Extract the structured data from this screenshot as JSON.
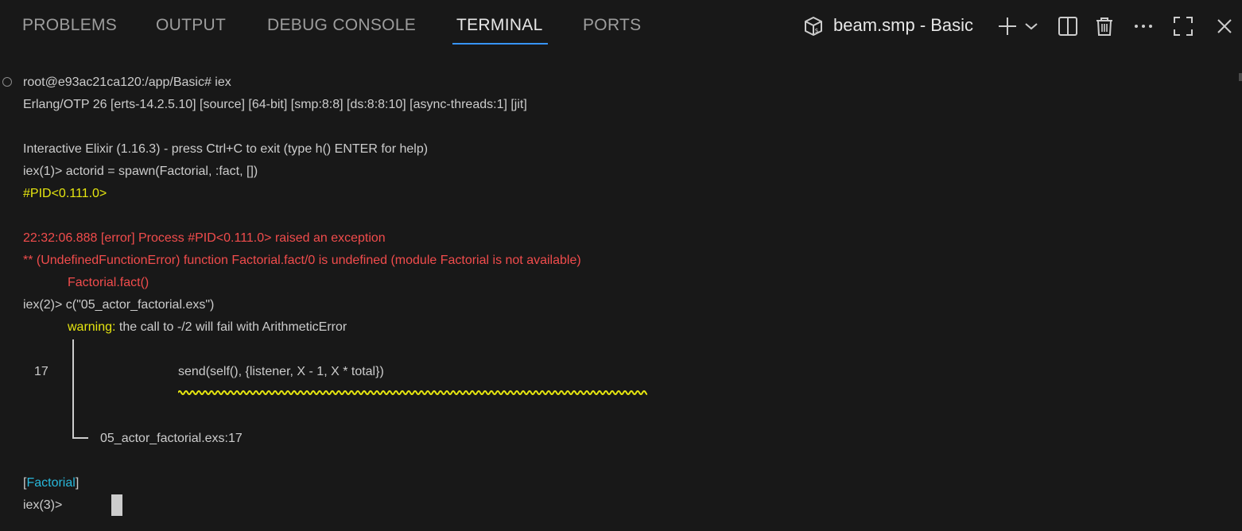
{
  "tabs": [
    {
      "label": "PROBLEMS"
    },
    {
      "label": "OUTPUT"
    },
    {
      "label": "DEBUG CONSOLE"
    },
    {
      "label": "TERMINAL",
      "active": true
    },
    {
      "label": "PORTS"
    }
  ],
  "terminal_toolbar": {
    "terminal_name": "beam.smp - Basic",
    "icons": [
      "terminal-profile-icon",
      "plus-icon",
      "chevron-down-icon",
      "split-icon",
      "trash-icon",
      "more-icon",
      "maximize-icon",
      "close-icon"
    ]
  },
  "terminal": {
    "lines": {
      "l1": "root@e93ac21ca120:/app/Basic# iex",
      "l2": "Erlang/OTP 26 [erts-14.2.5.10] [source] [64-bit] [smp:8:8] [ds:8:8:10] [async-threads:1] [jit]",
      "l3": "Interactive Elixir (1.16.3) - press Ctrl+C to exit (type h() ENTER for help)",
      "l4": "iex(1)> actorid = spawn(Factorial, :fact, [])",
      "l5": "#PID<0.111.0>",
      "l6": "22:32:06.888 [error] Process #PID<0.111.0> raised an exception",
      "l7": "** (UndefinedFunctionError) function Factorial.fact/0 is undefined (module Factorial is not available)",
      "l8": "Factorial.fact()",
      "l9": "iex(2)> c(\"05_actor_factorial.exs\")",
      "l10_warning": "warning:",
      "l10_rest": " the call to -/2 will fail with ArithmeticError",
      "l11_lineno": "17",
      "l11_code": "send(self(), {listener, X - 1, X * total})",
      "l12": "05_actor_factorial.exs:17",
      "l13_open": "[",
      "l13_module": "Factorial",
      "l13_close": "]",
      "l14": "iex(3)> "
    }
  },
  "colors": {
    "background": "#181818",
    "text": "#cccccc",
    "yellow": "#e5e510",
    "red": "#f14c4c",
    "cyan": "#29b8db",
    "active_tab_underline": "#3794ff"
  }
}
